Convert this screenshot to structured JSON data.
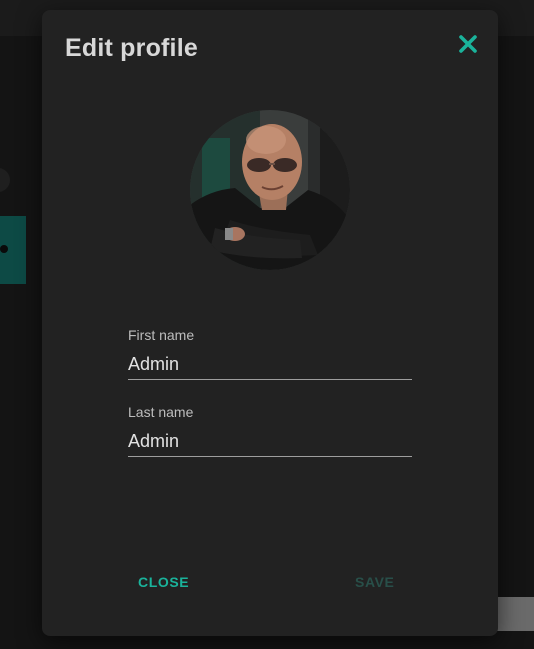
{
  "dialog": {
    "title": "Edit profile",
    "close_icon": "close-x-icon",
    "avatar_alt": "profile photo"
  },
  "form": {
    "first_name": {
      "label": "First name",
      "value": "Admin"
    },
    "last_name": {
      "label": "Last name",
      "value": "Admin"
    }
  },
  "actions": {
    "close_label": "CLOSE",
    "save_label": "SAVE",
    "save_enabled": false
  },
  "colors": {
    "accent": "#1ab39b",
    "accent_disabled": "#284f49",
    "dialog_bg": "#222222",
    "backdrop": "#141414"
  }
}
